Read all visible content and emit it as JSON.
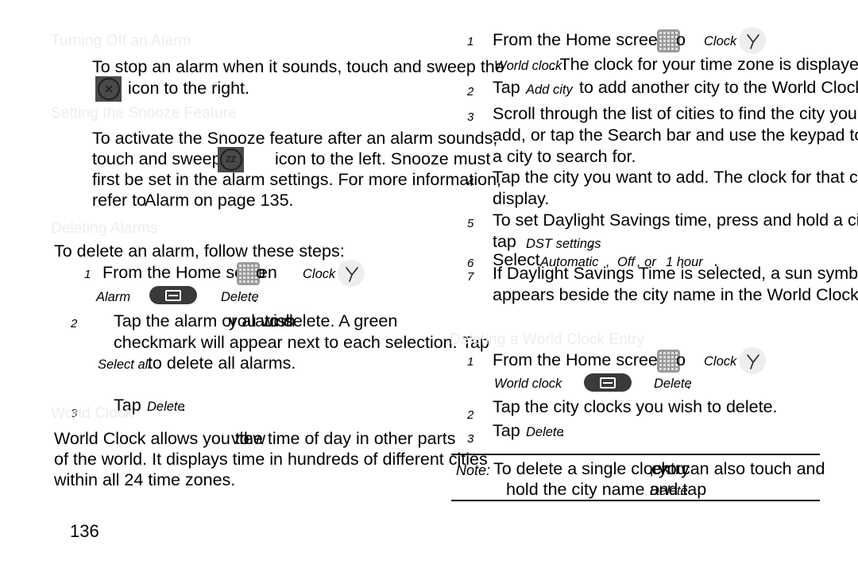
{
  "document": {
    "page_number": "136",
    "page_label": "136"
  },
  "left_column": {
    "sections": [
      {
        "heading": "Turning Off an Alarm",
        "body_lines": [
          "To stop an alarm when it sounds, touch and sweep the",
          "icon to the right."
        ],
        "icon": "alarm-dismiss-icon"
      },
      {
        "heading": "Setting the Snooze Feature",
        "body_lines": [
          "To activate the Snooze feature after an alarm sounds,",
          "touch and sweep",
          "icon to the left. Snooze must",
          "first be set in the alarm settings. For more information,",
          "refer to",
          "Alarm",
          " on page 135."
        ],
        "icon": "snooze-icon"
      },
      {
        "heading": "Deleting Alarms",
        "intro": "To delete an alarm, follow these steps:",
        "steps": [
          {
            "number": "1",
            "parts": [
              "From the Home screen",
              "o",
              "Clock",
              "Alarm",
              "Delete",
              "."
            ]
          },
          {
            "number": "2",
            "lines": [
              "Tap the alarm or alarms",
              "you wish",
              " to delete. A green",
              "checkmark will appear next to each selection. Tap",
              "Select all",
              " to delete all alarms."
            ]
          },
          {
            "number": "3",
            "lines": [
              "Tap",
              "Delete",
              "."
            ]
          }
        ]
      },
      {
        "heading": "World Clock",
        "body_lines": [
          "World Clock allows you to",
          "view",
          "the time of day in other parts",
          "of the world. It displays time in hundreds of different cities",
          "within all 24 time zones."
        ]
      }
    ]
  },
  "right_column": {
    "world_clock_steps": [
      {
        "number": "1",
        "parts": [
          "From the Home screen",
          "o",
          "Clock",
          "World clock",
          ". The clock for your time zone is displayed."
        ]
      },
      {
        "number": "2",
        "lines": [
          "Tap",
          "Add city",
          " to add another city to the World Clock."
        ]
      },
      {
        "number": "3",
        "lines": [
          "Scroll through the list of cities to find the city you want to",
          "add, or tap the Search bar and use the keypad to enter",
          "a city to search for."
        ]
      },
      {
        "number": "4",
        "lines": [
          "Tap the city you want to add. The clock for that city will",
          "display."
        ]
      },
      {
        "number": "5",
        "lines": [
          "To set Daylight Savings time, press and hold a city, then",
          "tap",
          "DST settings",
          "."
        ]
      },
      {
        "number": "6",
        "lines": [
          "Select",
          "Automatic",
          ", ",
          "Off",
          ", or ",
          "1 hour",
          "."
        ]
      },
      {
        "number": "7",
        "lines": [
          "If Daylight Savings Time is selected, a sun symbol",
          "appears beside the city name in the World Clock list."
        ]
      }
    ],
    "delete_section": {
      "heading": "Deleting a World Clock Entry",
      "steps": [
        {
          "number": "1",
          "parts": [
            "From the Home screen",
            "o",
            "Clock",
            "World clock",
            "Delete",
            "."
          ]
        },
        {
          "number": "2",
          "lines": [
            "Tap the city clocks you wish to delete."
          ]
        },
        {
          "number": "3",
          "lines": [
            "Tap",
            "Delete",
            "."
          ]
        }
      ]
    },
    "note": {
      "label": "Note:",
      "lines": [
        "To delete a single clock ",
        "entry",
        ", you",
        " can also touch and",
        "hold the city name and tap",
        "Delete",
        "."
      ]
    }
  },
  "icons": {
    "grid": "app-grid-icon",
    "clock": "clock-icon",
    "menu_pill": "menu-key-icon",
    "alarm_dismiss": "alarm-dismiss-icon",
    "snooze": "snooze-icon"
  }
}
